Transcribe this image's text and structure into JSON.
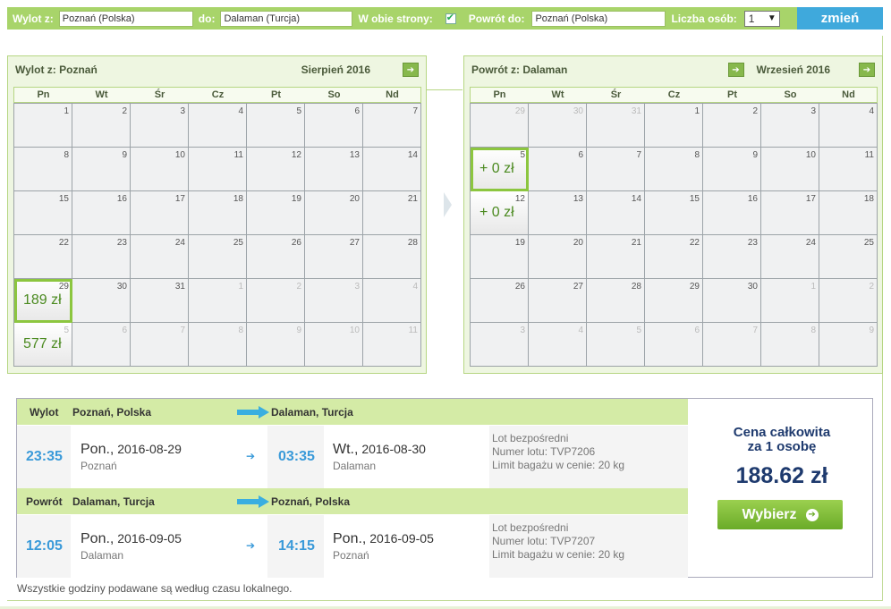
{
  "search": {
    "from_label": "Wylot z:",
    "from_value": "Poznań (Polska)",
    "to_label": "do:",
    "to_value": "Dalaman (Turcja)",
    "roundtrip_label": "W obie strony:",
    "roundtrip_checked": true,
    "return_label": "Powrót do:",
    "return_value": "Poznań (Polska)",
    "persons_label": "Liczba osób:",
    "persons_value": "1",
    "change_label": "zmień"
  },
  "outbound_cal": {
    "from_label": "Wylot z: Poznań",
    "month": "Sierpień 2016",
    "dow": [
      "Pn",
      "Wt",
      "Śr",
      "Cz",
      "Pt",
      "So",
      "Nd"
    ],
    "days": [
      {
        "n": "1"
      },
      {
        "n": "2"
      },
      {
        "n": "3"
      },
      {
        "n": "4"
      },
      {
        "n": "5"
      },
      {
        "n": "6"
      },
      {
        "n": "7"
      },
      {
        "n": "8"
      },
      {
        "n": "9"
      },
      {
        "n": "10"
      },
      {
        "n": "11"
      },
      {
        "n": "12"
      },
      {
        "n": "13"
      },
      {
        "n": "14"
      },
      {
        "n": "15"
      },
      {
        "n": "16"
      },
      {
        "n": "17"
      },
      {
        "n": "18"
      },
      {
        "n": "19"
      },
      {
        "n": "20"
      },
      {
        "n": "21"
      },
      {
        "n": "22"
      },
      {
        "n": "23"
      },
      {
        "n": "24"
      },
      {
        "n": "25"
      },
      {
        "n": "26"
      },
      {
        "n": "27"
      },
      {
        "n": "28"
      },
      {
        "n": "29",
        "price": "189 zł",
        "selected": true
      },
      {
        "n": "30"
      },
      {
        "n": "31"
      },
      {
        "n": "1",
        "other": true
      },
      {
        "n": "2",
        "other": true
      },
      {
        "n": "3",
        "other": true
      },
      {
        "n": "4",
        "other": true
      },
      {
        "n": "5",
        "other": true,
        "price": "577 zł"
      },
      {
        "n": "6",
        "other": true
      },
      {
        "n": "7",
        "other": true
      },
      {
        "n": "8",
        "other": true
      },
      {
        "n": "9",
        "other": true
      },
      {
        "n": "10",
        "other": true
      },
      {
        "n": "11",
        "other": true
      }
    ]
  },
  "return_cal": {
    "from_label": "Powrót z: Dalaman",
    "month": "Wrzesień 2016",
    "dow": [
      "Pn",
      "Wt",
      "Śr",
      "Cz",
      "Pt",
      "So",
      "Nd"
    ],
    "days": [
      {
        "n": "29",
        "other": true
      },
      {
        "n": "30",
        "other": true
      },
      {
        "n": "31",
        "other": true
      },
      {
        "n": "1"
      },
      {
        "n": "2"
      },
      {
        "n": "3"
      },
      {
        "n": "4"
      },
      {
        "n": "5",
        "price": "+ 0 zł",
        "selected": true
      },
      {
        "n": "6"
      },
      {
        "n": "7"
      },
      {
        "n": "8"
      },
      {
        "n": "9"
      },
      {
        "n": "10"
      },
      {
        "n": "11"
      },
      {
        "n": "12",
        "price": "+ 0 zł"
      },
      {
        "n": "13"
      },
      {
        "n": "14"
      },
      {
        "n": "15"
      },
      {
        "n": "16"
      },
      {
        "n": "17"
      },
      {
        "n": "18"
      },
      {
        "n": "19"
      },
      {
        "n": "20"
      },
      {
        "n": "21"
      },
      {
        "n": "22"
      },
      {
        "n": "23"
      },
      {
        "n": "24"
      },
      {
        "n": "25"
      },
      {
        "n": "26"
      },
      {
        "n": "27"
      },
      {
        "n": "28"
      },
      {
        "n": "29"
      },
      {
        "n": "30"
      },
      {
        "n": "1",
        "other": true
      },
      {
        "n": "2",
        "other": true
      },
      {
        "n": "3",
        "other": true
      },
      {
        "n": "4",
        "other": true
      },
      {
        "n": "5",
        "other": true
      },
      {
        "n": "6",
        "other": true
      },
      {
        "n": "7",
        "other": true
      },
      {
        "n": "8",
        "other": true
      },
      {
        "n": "9",
        "other": true
      }
    ]
  },
  "outbound": {
    "label": "Wylot",
    "from": "Poznań, Polska",
    "to": "Dalaman, Turcja",
    "dep_time": "23:35",
    "dep_day": "Pon.,",
    "dep_date": " 2016-08-29",
    "dep_city": "Poznań",
    "arr_time": "03:35",
    "arr_day": "Wt.,",
    "arr_date": " 2016-08-30",
    "arr_city": "Dalaman",
    "info1": "Lot bezpośredni",
    "info2": "Numer lotu: TVP7206",
    "info3": "Limit bagażu w cenie: 20 kg"
  },
  "inbound": {
    "label": "Powrót",
    "from": "Dalaman, Turcja",
    "to": "Poznań, Polska",
    "dep_time": "12:05",
    "dep_day": "Pon.,",
    "dep_date": " 2016-09-05",
    "dep_city": "Dalaman",
    "arr_time": "14:15",
    "arr_day": "Pon.,",
    "arr_date": " 2016-09-05",
    "arr_city": "Poznań",
    "info1": "Lot bezpośredni",
    "info2": "Numer lotu: TVP7207",
    "info3": "Limit bagażu w cenie: 20 kg"
  },
  "price": {
    "label_line1": "Cena całkowita",
    "label_line2": "za 1 osobę",
    "amount": "188.62 zł",
    "button": "Wybierz"
  },
  "footnote": "Wszystkie godziny podawane są według czasu lokalnego."
}
